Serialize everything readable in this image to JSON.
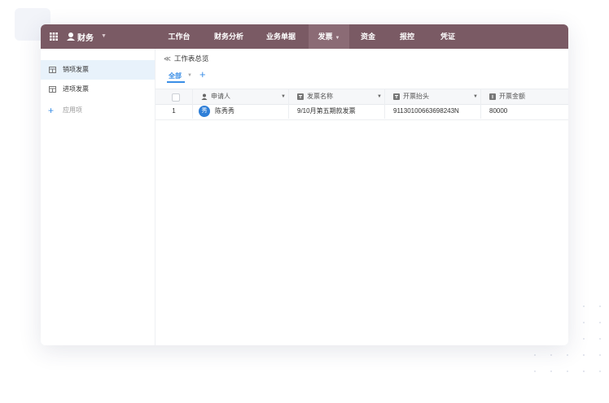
{
  "topbar": {
    "app_name": "财务",
    "nav": [
      {
        "label": "工作台"
      },
      {
        "label": "财务分析"
      },
      {
        "label": "业务单据"
      },
      {
        "label": "发票",
        "active": true,
        "has_caret": true
      },
      {
        "label": "资金"
      },
      {
        "label": "报控"
      },
      {
        "label": "凭证"
      }
    ],
    "colors": {
      "bar": "#7a5a64",
      "active": "#8b6b75"
    }
  },
  "sidebar": {
    "items": [
      {
        "label": "销项发票",
        "icon": "table-icon",
        "active": true
      },
      {
        "label": "进项发票",
        "icon": "table-icon"
      }
    ],
    "add_label": "应用项"
  },
  "main": {
    "breadcrumb": "工作表总览",
    "view_tab": "全部",
    "table": {
      "columns": [
        {
          "label": "申请人",
          "icon": "person-icon"
        },
        {
          "label": "发票名称",
          "icon": "text-field-icon"
        },
        {
          "label": "开票抬头",
          "icon": "text-field-icon"
        },
        {
          "label": "开票金额",
          "icon": "number-field-icon"
        }
      ],
      "rows": [
        {
          "index": "1",
          "avatar": "秀",
          "applicant": "陈秀秀",
          "invoice_name": "9/10月第五期款发票",
          "title": "91130100663698243N",
          "amount": "80000"
        }
      ]
    },
    "accent": "#3a8ee6"
  }
}
